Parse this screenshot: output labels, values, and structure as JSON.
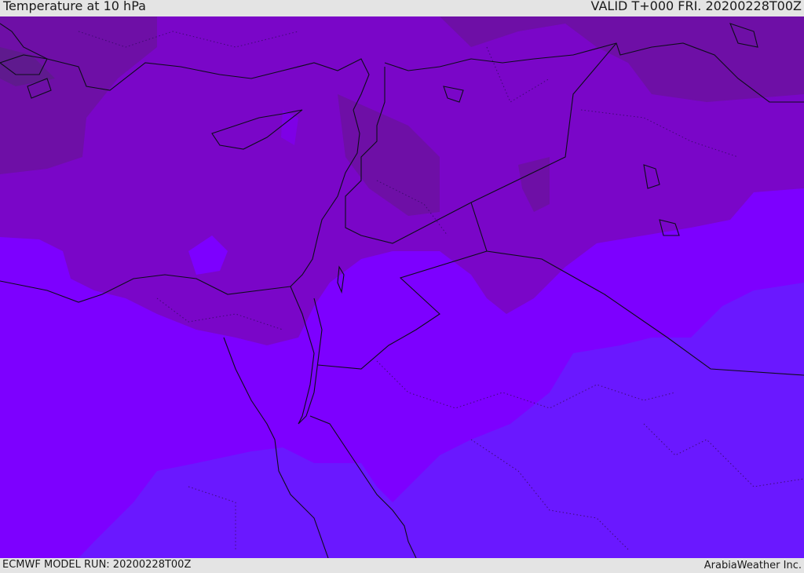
{
  "header": {
    "title": "Temperature at 10 hPa",
    "valid": "VALID T+000 FRI. 20200228T00Z"
  },
  "footer": {
    "model_run": "ECMWF MODEL RUN: 20200228T00Z",
    "credit": "ArabiaWeather Inc."
  },
  "map": {
    "field_colors": [
      "#6e0fa6",
      "#7a06c8",
      "#7e00e6",
      "#7d00ff",
      "#6a18ff"
    ]
  }
}
